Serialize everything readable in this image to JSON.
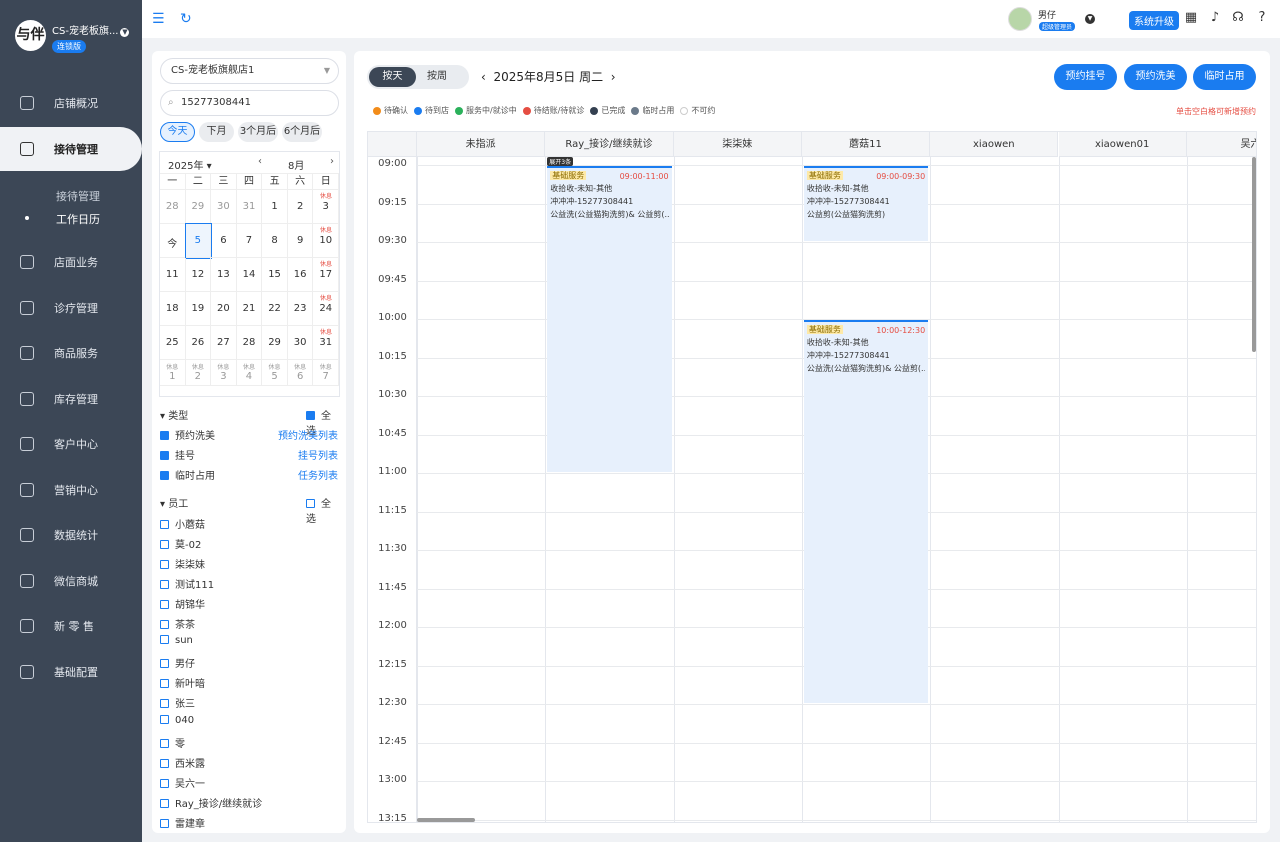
{
  "app": {
    "shop_name": "CS-宠老板旗...",
    "chain_badge": "连锁版",
    "logo_text": "与伴"
  },
  "nav": [
    {
      "label": "店铺概况",
      "icon": "monitor-icon"
    },
    {
      "label": "接待管理",
      "icon": "reception-icon"
    },
    {
      "label": "店面业务",
      "icon": "store-icon"
    },
    {
      "label": "诊疗管理",
      "icon": "medical-icon"
    },
    {
      "label": "商品服务",
      "icon": "goods-icon"
    },
    {
      "label": "库存管理",
      "icon": "inventory-icon"
    },
    {
      "label": "客户中心",
      "icon": "customer-icon"
    },
    {
      "label": "营销中心",
      "icon": "marketing-icon"
    },
    {
      "label": "数据统计",
      "icon": "stats-icon"
    },
    {
      "label": "微信商城",
      "icon": "wechat-icon"
    },
    {
      "label": "新 零 售",
      "icon": "retail-icon"
    },
    {
      "label": "基础配置",
      "icon": "config-icon"
    }
  ],
  "subnav": [
    {
      "label": "接待管理"
    },
    {
      "label": "工作日历"
    }
  ],
  "header": {
    "user": "男仔",
    "role": "超级管理员",
    "upgrade": "系统升级"
  },
  "left": {
    "store": "CS-宠老板旗舰店1",
    "search": "15277308441",
    "quick": [
      "今天",
      "下月",
      "3个月后",
      "6个月后"
    ],
    "cal_year": "2025年",
    "cal_month": "8月",
    "weekdays": [
      "一",
      "二",
      "三",
      "四",
      "五",
      "六",
      "日"
    ],
    "rest_label": "休息",
    "weeks": [
      [
        "28",
        "29",
        "30",
        "31",
        "1",
        "2",
        "3"
      ],
      [
        "今",
        "5",
        "6",
        "7",
        "8",
        "9",
        "10"
      ],
      [
        "11",
        "12",
        "13",
        "14",
        "15",
        "16",
        "17"
      ],
      [
        "18",
        "19",
        "20",
        "21",
        "22",
        "23",
        "24"
      ],
      [
        "25",
        "26",
        "27",
        "28",
        "29",
        "30",
        "31"
      ]
    ],
    "next_week": [
      "1",
      "2",
      "3",
      "4",
      "5",
      "6",
      "7"
    ],
    "type_title": "类型",
    "select_all": "全选",
    "types": [
      {
        "label": "预约洗美",
        "link": "预约洗美列表"
      },
      {
        "label": "挂号",
        "link": "挂号列表"
      },
      {
        "label": "临时占用",
        "link": "任务列表"
      }
    ],
    "staff_title": "员工",
    "staff": [
      "小蘑菇",
      "莫-02",
      "柒柒妹",
      "测试111",
      "胡锦华",
      "茶茶",
      "sun",
      "男仔",
      "新叶暗",
      "张三",
      "040",
      "零",
      "西米露",
      "吴六一",
      "Ray_接诊/继续就诊",
      "雷建章"
    ]
  },
  "main": {
    "mode_day": "按天",
    "mode_week": "按周",
    "date": "2025年8月5日 周二",
    "actions": [
      "预约挂号",
      "预约洗美",
      "临时占用"
    ],
    "legend": [
      {
        "label": "待确认",
        "color": "#f28c1a"
      },
      {
        "label": "待到店",
        "color": "#1a7cf0"
      },
      {
        "label": "服务中/就诊中",
        "color": "#2bb15b"
      },
      {
        "label": "待结账/待就诊",
        "color": "#e54d42"
      },
      {
        "label": "已完成",
        "color": "#344050"
      },
      {
        "label": "临时占用",
        "color": "#6b7a8a"
      },
      {
        "label": "不可约",
        "color": "#ffffff"
      }
    ],
    "hint": "单击空白格可新增预约",
    "columns": [
      "未指派",
      "Ray_接诊/继续就诊",
      "柒柒妹",
      "蘑菇11",
      "xiaowen",
      "xiaowen01",
      "吴六"
    ],
    "times": [
      "09:00",
      "09:15",
      "09:30",
      "09:45",
      "10:00",
      "10:15",
      "10:30",
      "10:45",
      "11:00",
      "11:15",
      "11:30",
      "11:45",
      "12:00",
      "12:15",
      "12:30",
      "12:45",
      "13:00",
      "13:15"
    ],
    "expand_label": "展开3条",
    "appointments": [
      {
        "tag": "基础服务",
        "time": "09:00-11:00",
        "line1": "收拾收-未知-其他",
        "line2": "冲冲冲-15277308441",
        "line3": "公益洗(公益猫狗洗剪)& 公益剪(..."
      },
      {
        "tag": "基础服务",
        "time": "09:00-09:30",
        "line1": "收拾收-未知-其他",
        "line2": "冲冲冲-15277308441",
        "line3": "公益剪(公益猫狗洗剪)"
      },
      {
        "tag": "基础服务",
        "time": "10:00-12:30",
        "line1": "收拾收-未知-其他",
        "line2": "冲冲冲-15277308441",
        "line3": "公益洗(公益猫狗洗剪)& 公益剪(..."
      }
    ]
  }
}
